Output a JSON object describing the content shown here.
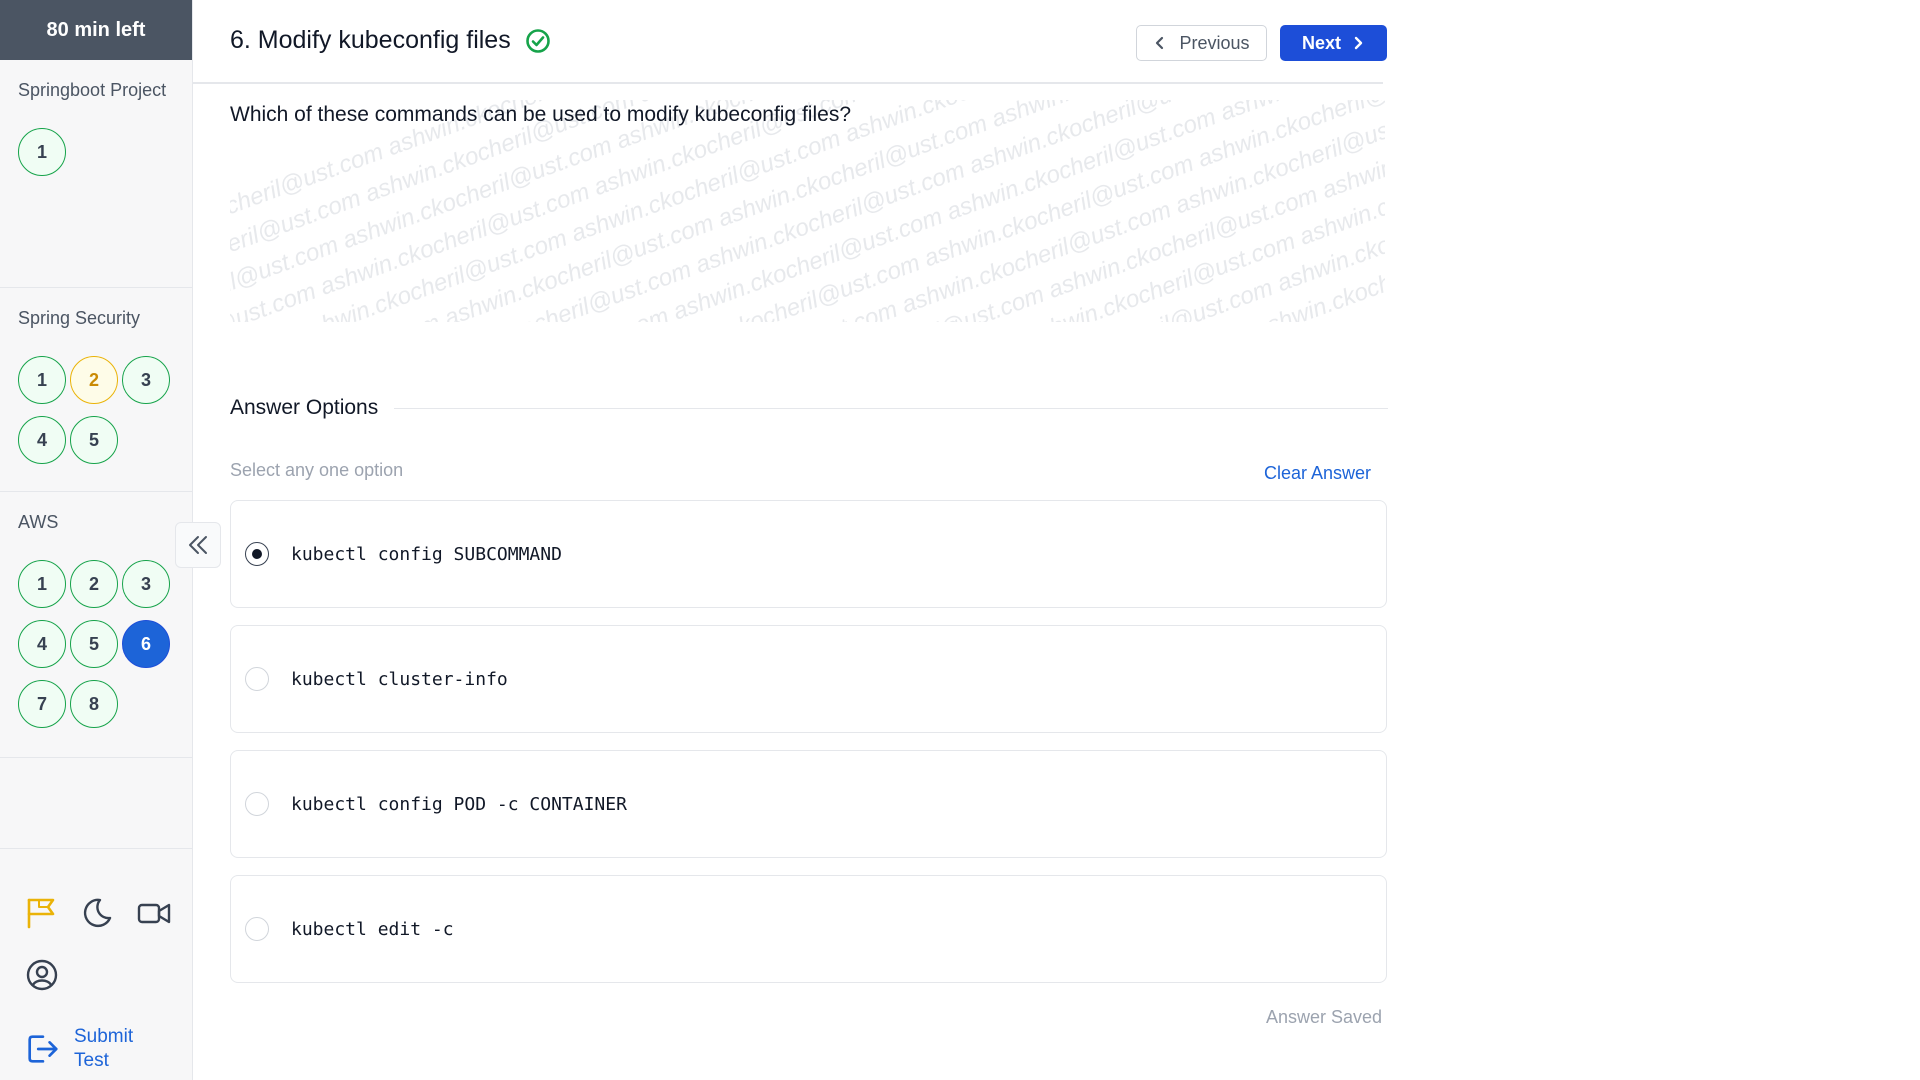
{
  "sidebar": {
    "timer": "80 min left",
    "sections": [
      {
        "title": "Springboot Project",
        "questions": [
          {
            "label": "1",
            "state": "answered"
          }
        ]
      },
      {
        "title": "Spring Security",
        "questions": [
          {
            "label": "1",
            "state": "answered"
          },
          {
            "label": "2",
            "state": "review"
          },
          {
            "label": "3",
            "state": "answered"
          },
          {
            "label": "4",
            "state": "answered"
          },
          {
            "label": "5",
            "state": "answered"
          }
        ]
      },
      {
        "title": "AWS",
        "questions": [
          {
            "label": "1",
            "state": "answered"
          },
          {
            "label": "2",
            "state": "answered"
          },
          {
            "label": "3",
            "state": "answered"
          },
          {
            "label": "4",
            "state": "answered"
          },
          {
            "label": "5",
            "state": "answered"
          },
          {
            "label": "6",
            "state": "current"
          },
          {
            "label": "7",
            "state": "answered"
          },
          {
            "label": "8",
            "state": "answered"
          }
        ]
      }
    ],
    "icons": [
      "flag-icon",
      "moon-icon",
      "video-camera-icon",
      "user-circle-icon"
    ],
    "submit_label": "Submit Test"
  },
  "header": {
    "question_title": "6. Modify kubeconfig files",
    "prev_label": "Previous",
    "next_label": "Next"
  },
  "question": {
    "text": "Which of these commands can be used to modify kubeconfig files?",
    "watermark": "ashwin.ckocheril@ust.com"
  },
  "answers": {
    "heading": "Answer Options",
    "hint": "Select any one option",
    "clear_label": "Clear Answer",
    "options": [
      {
        "text": "kubectl config SUBCOMMAND",
        "selected": true
      },
      {
        "text": "kubectl cluster-info",
        "selected": false
      },
      {
        "text": "kubectl config POD -c CONTAINER",
        "selected": false
      },
      {
        "text": "kubectl edit -c",
        "selected": false
      }
    ],
    "status": "Answer Saved"
  },
  "colors": {
    "accent": "#1d4ed8",
    "answered_border": "#16a34a",
    "review_border": "#eab308",
    "flag": "#eab308"
  }
}
